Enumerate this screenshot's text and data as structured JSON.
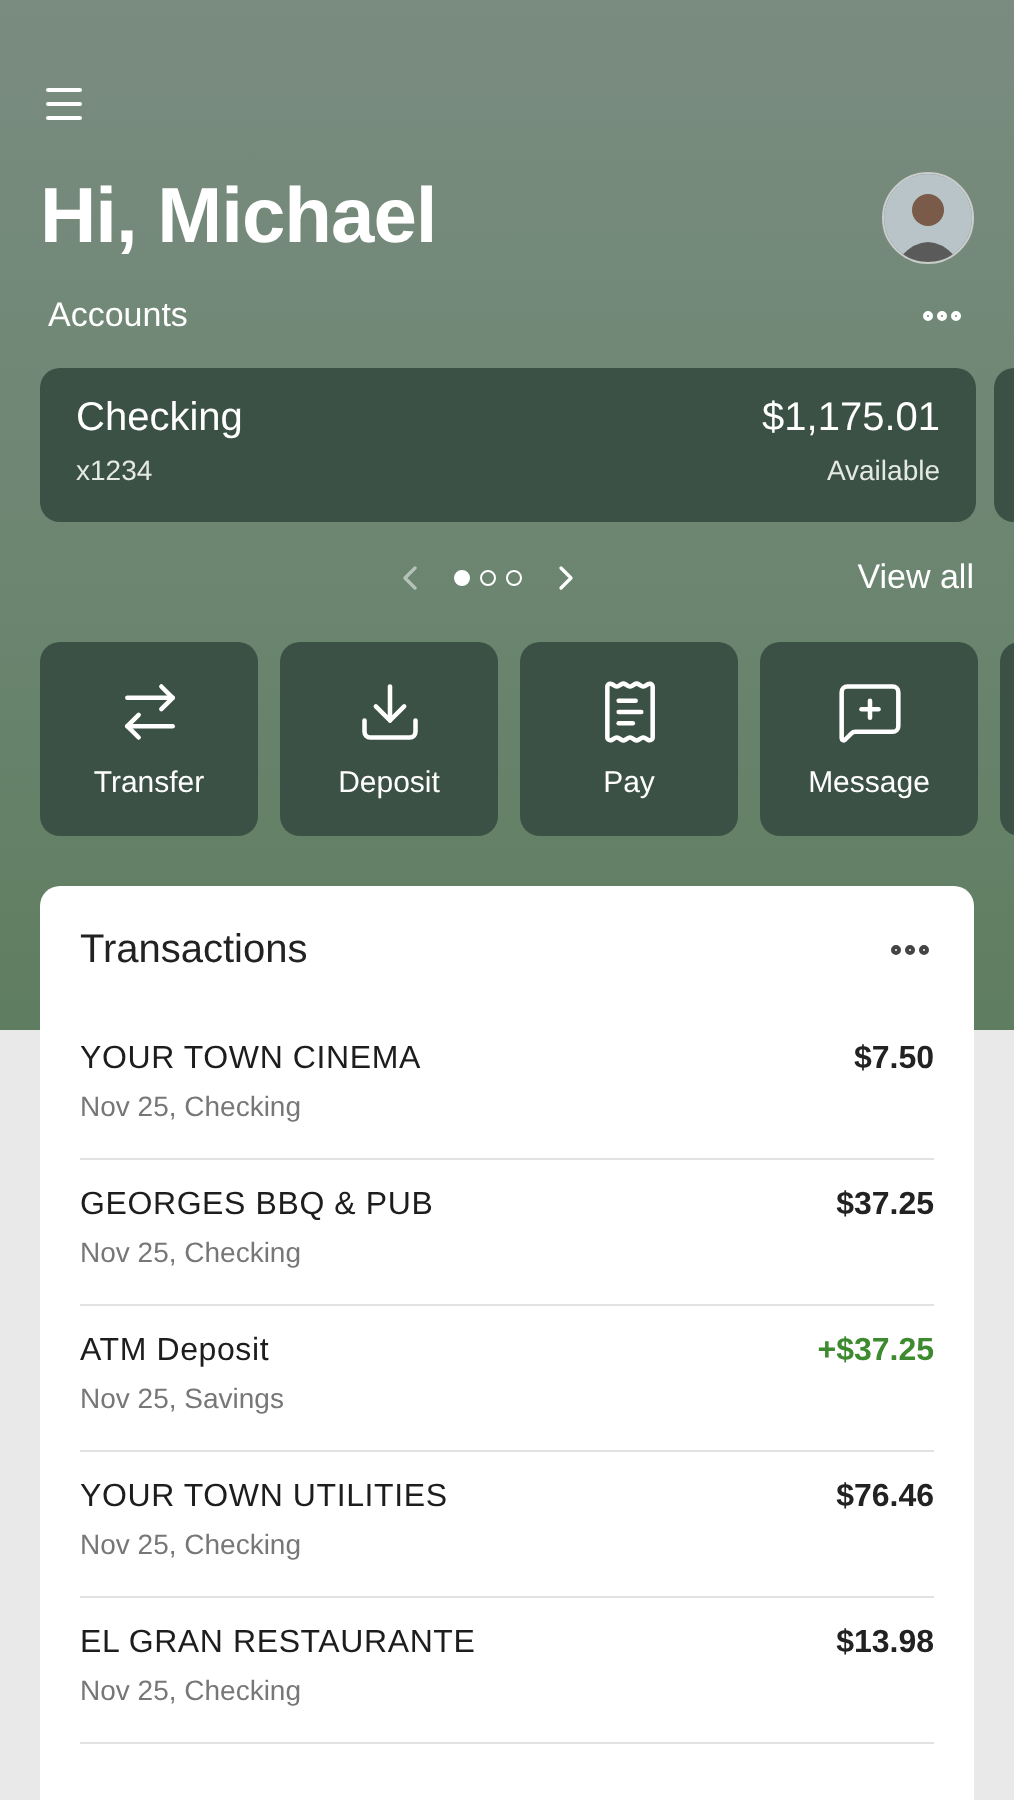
{
  "greeting": "Hi, Michael",
  "accounts": {
    "title": "Accounts",
    "cards": [
      {
        "name": "Checking",
        "number": "x1234",
        "balance": "$1,175.01",
        "balance_label": "Available"
      }
    ],
    "pager": [
      {
        "selected": true
      },
      {
        "selected": false
      },
      {
        "selected": false
      }
    ],
    "view_all": "View all"
  },
  "actions": [
    {
      "kind": "transfer",
      "label": "Transfer"
    },
    {
      "kind": "deposit",
      "label": "Deposit"
    },
    {
      "kind": "pay",
      "label": "Pay"
    },
    {
      "kind": "message",
      "label": "Message"
    }
  ],
  "transactions": {
    "title": "Transactions",
    "rows": [
      {
        "name": "YOUR TOWN CINEMA",
        "detail": "Nov 25, Checking",
        "amount": "$7.50",
        "kind": "debit"
      },
      {
        "name": "GEORGES BBQ & PUB",
        "detail": "Nov 25, Checking",
        "amount": "$37.25",
        "kind": "debit"
      },
      {
        "name": "ATM Deposit",
        "detail": "Nov 25, Savings",
        "amount": "+$37.25",
        "kind": "credit"
      },
      {
        "name": "YOUR TOWN UTILITIES",
        "detail": "Nov 25, Checking",
        "amount": "$76.46",
        "kind": "debit"
      },
      {
        "name": "EL GRAN RESTAURANTE",
        "detail": "Nov 25, Checking",
        "amount": "$13.98",
        "kind": "debit"
      }
    ]
  }
}
